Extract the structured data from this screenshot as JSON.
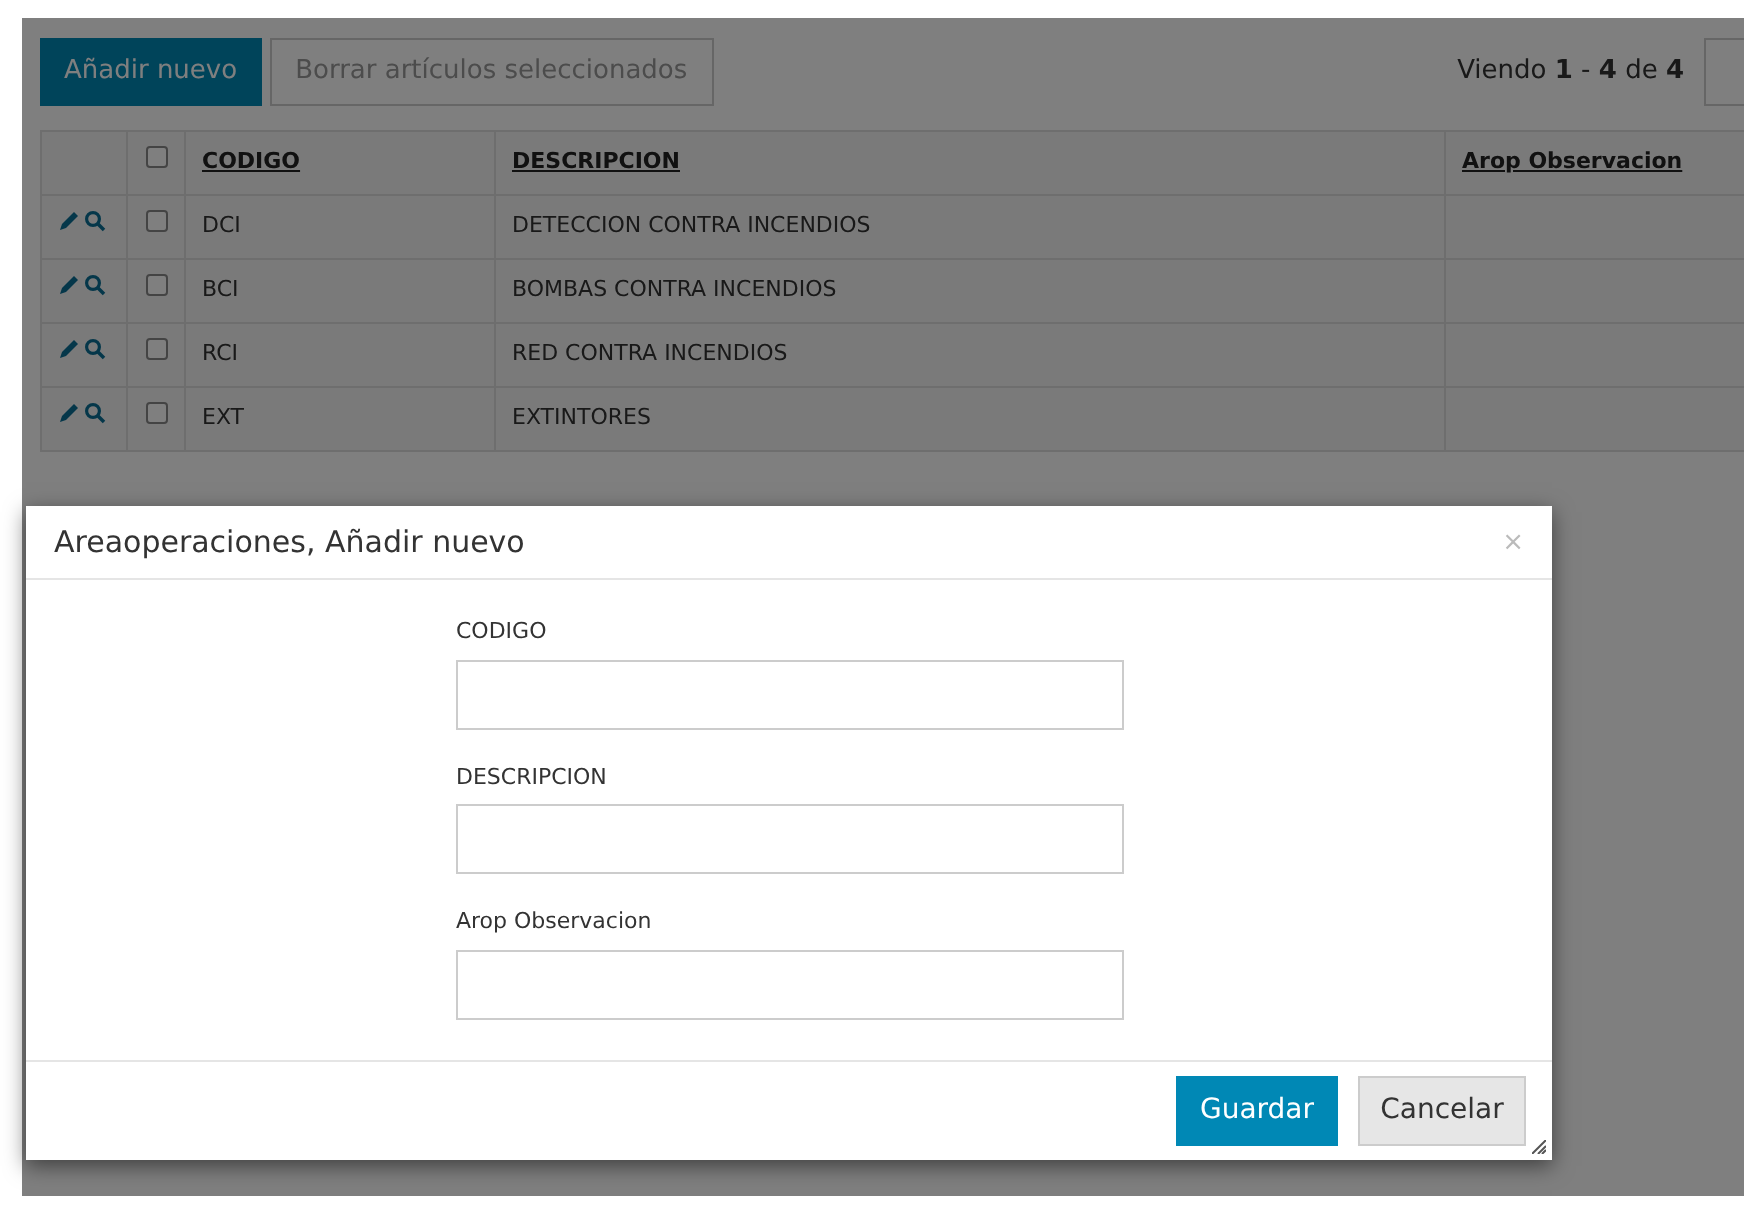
{
  "toolbar": {
    "add_button": "Añadir nuevo",
    "delete_button": "Borrar artículos seleccionados",
    "paging": "Viendo **1** - **4** de **4**"
  },
  "table": {
    "select_all_checked": false,
    "columns": [
      "CODIGO",
      "DESCRIPCION",
      "Arop Observacion"
    ],
    "rows": [
      {
        "checked": false,
        "cells": [
          "DCI",
          "DETECCION CONTRA INCENDIOS",
          ""
        ]
      },
      {
        "checked": false,
        "cells": [
          "BCI",
          "BOMBAS CONTRA INCENDIOS",
          ""
        ]
      },
      {
        "checked": false,
        "cells": [
          "RCI",
          "RED CONTRA INCENDIOS",
          ""
        ]
      },
      {
        "checked": false,
        "cells": [
          "EXT",
          "EXTINTORES",
          ""
        ]
      }
    ]
  },
  "dialog": {
    "title": "Areaoperaciones, Añadir nuevo",
    "close": "×",
    "fields": [
      {
        "label": "CODIGO"
      },
      {
        "label": "DESCRIPCION"
      },
      {
        "label": "Arop Observacion"
      }
    ],
    "buttons": [
      {
        "label": "Guardar",
        "kind": "primary"
      },
      {
        "label": "Cancelar",
        "kind": "secondary"
      }
    ]
  }
}
